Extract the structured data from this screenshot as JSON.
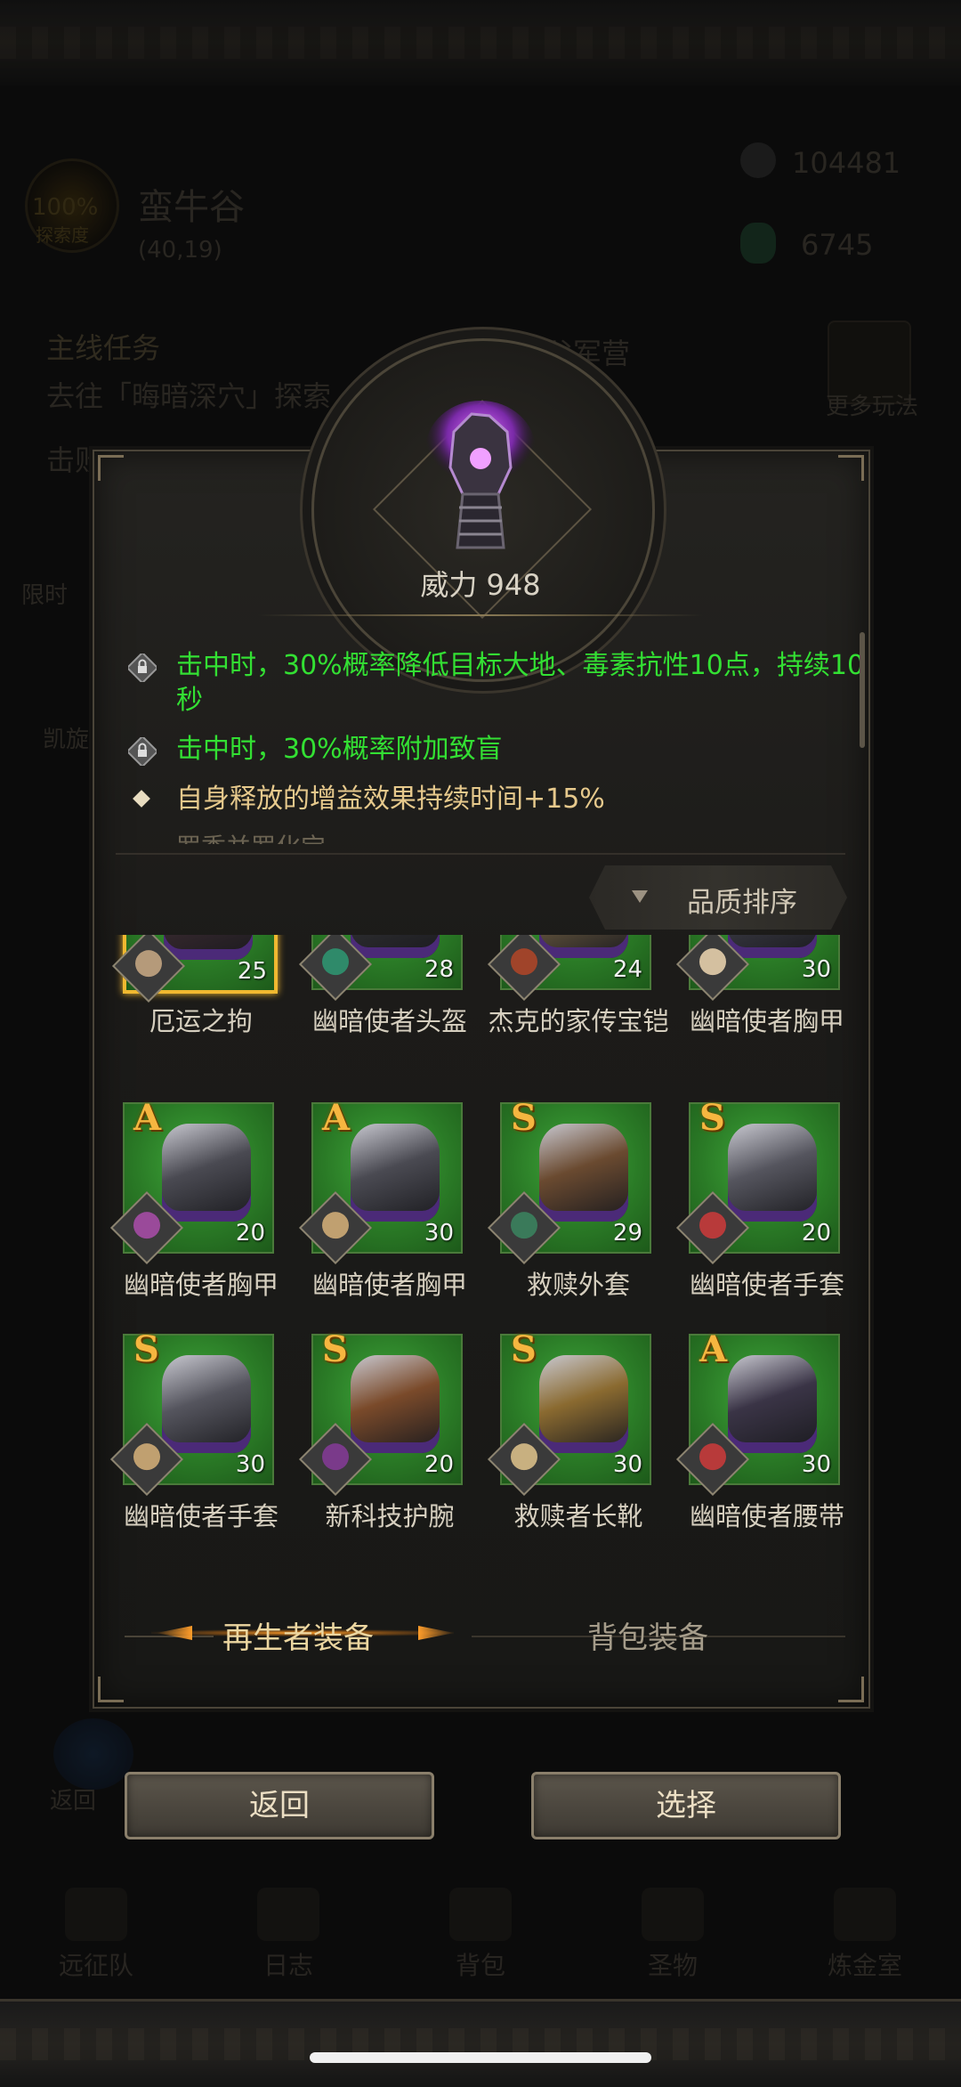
{
  "background": {
    "location_name": "蛮牛谷",
    "location_coords": "(40,19)",
    "exploration_percent": "100%",
    "exploration_label": "探索度",
    "currency_1": "104481",
    "currency_2": "6745",
    "quest_header": "主线任务",
    "quest_text": "去往「晦暗深穴」探索",
    "quest_sub": "击败…",
    "camp_label": "…谷军营",
    "more_play": "更多玩法",
    "left_labels": [
      "限时",
      "凯旋"
    ],
    "return_label": "返回",
    "nav": [
      "远征队",
      "日志",
      "背包",
      "圣物",
      "炼金室"
    ]
  },
  "item_detail": {
    "power": "威力 948",
    "attributes": [
      {
        "icon": "lock-icon",
        "color": "#33e033",
        "text": "击中时，30%概率降低目标大地、毒素抗性10点，持续10秒"
      },
      {
        "icon": "lock-icon",
        "color": "#33e033",
        "text": "击中时，30%概率附加致盲"
      },
      {
        "icon": "diamond-bullet-icon",
        "color": "#e6c98c",
        "text": "自身释放的增益效果持续时间+15%"
      }
    ],
    "partial_text": "罗季并罗化宝"
  },
  "sort": {
    "label": "品质排序"
  },
  "equipment": [
    {
      "name": "厄运之拘",
      "level": "25",
      "grade": "",
      "selected": true
    },
    {
      "name": "幽暗使者头盔",
      "level": "28",
      "grade": ""
    },
    {
      "name": "杰克的家传宝铠",
      "level": "24",
      "grade": ""
    },
    {
      "name": "幽暗使者胸甲",
      "level": "30",
      "grade": ""
    },
    {
      "name": "幽暗使者胸甲",
      "level": "20",
      "grade": "A"
    },
    {
      "name": "幽暗使者胸甲",
      "level": "30",
      "grade": "A"
    },
    {
      "name": "救赎外套",
      "level": "29",
      "grade": "S"
    },
    {
      "name": "幽暗使者手套",
      "level": "20",
      "grade": "S"
    },
    {
      "name": "幽暗使者手套",
      "level": "30",
      "grade": "S"
    },
    {
      "name": "新科技护腕",
      "level": "20",
      "grade": "S"
    },
    {
      "name": "救赎者长靴",
      "level": "30",
      "grade": "S"
    },
    {
      "name": "幽暗使者腰带",
      "level": "30",
      "grade": "A"
    }
  ],
  "tabs": {
    "active": "再生者装备",
    "inactive": "背包装备"
  },
  "buttons": {
    "back": "返回",
    "select": "选择"
  },
  "colors": {
    "accent_gold": "#f6b640",
    "attr_green": "#33e033",
    "card_green": "#2a7a26",
    "selected_border": "#f0b830"
  }
}
